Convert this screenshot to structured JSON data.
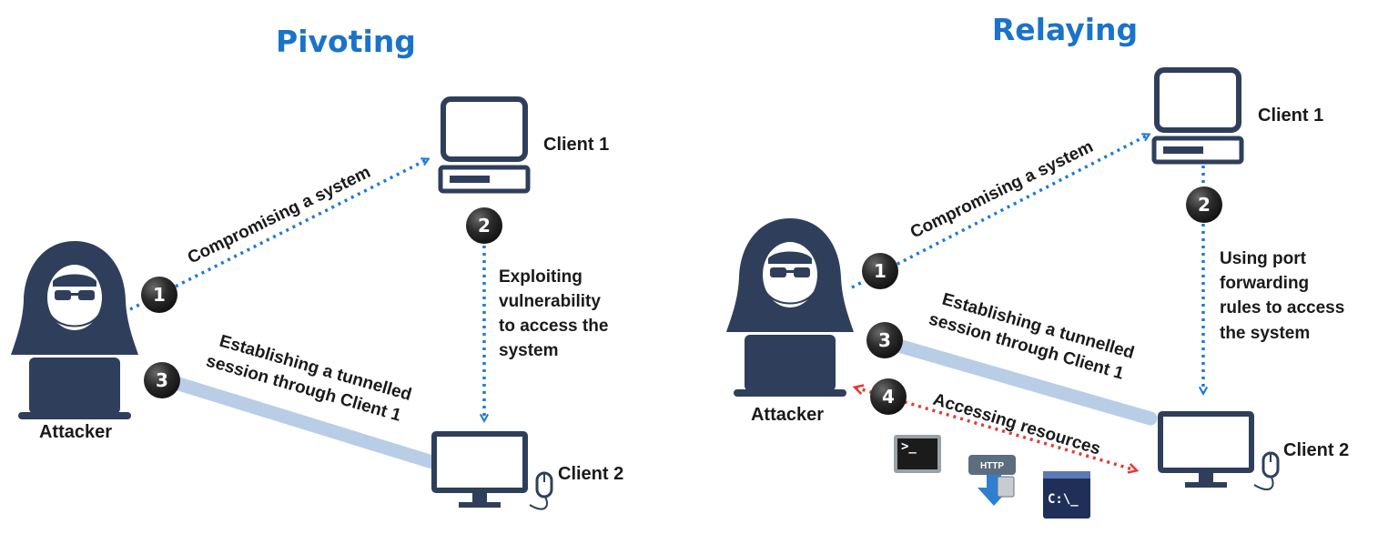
{
  "pivoting": {
    "title": "Pivoting",
    "attacker_label": "Attacker",
    "client1_label": "Client 1",
    "client2_label": "Client 2",
    "steps": [
      {
        "num": "1",
        "lines": [
          "Compromising a system"
        ]
      },
      {
        "num": "2",
        "lines": [
          "Exploiting",
          "vulnerability",
          "to access the",
          "system"
        ]
      },
      {
        "num": "3",
        "lines": [
          "Establishing a tunnelled",
          "session through Client 1"
        ]
      }
    ]
  },
  "relaying": {
    "title": "Relaying",
    "attacker_label": "Attacker",
    "client1_label": "Client 1",
    "client2_label": "Client 2",
    "steps": [
      {
        "num": "1",
        "lines": [
          "Compromising a system"
        ]
      },
      {
        "num": "2",
        "lines": [
          "Using port",
          "forwarding",
          "rules to access",
          "the system"
        ]
      },
      {
        "num": "3",
        "lines": [
          "Establishing a tunnelled",
          "session through Client 1"
        ]
      },
      {
        "num": "4",
        "lines": [
          "Accessing resources"
        ]
      }
    ],
    "resource_icons": [
      {
        "name": "terminal-icon",
        "text": ">_"
      },
      {
        "name": "http-download-icon",
        "text": "HTTP"
      },
      {
        "name": "command-prompt-icon",
        "text": "C:\\_"
      }
    ]
  },
  "colors": {
    "title": "#1a73c8",
    "dotted_arrow": "#1f7ad1",
    "red_arrow": "#e53935",
    "tunnel": "#b9cde6",
    "device": "#2f3f5b",
    "step_circle": "#2b2b2b"
  }
}
